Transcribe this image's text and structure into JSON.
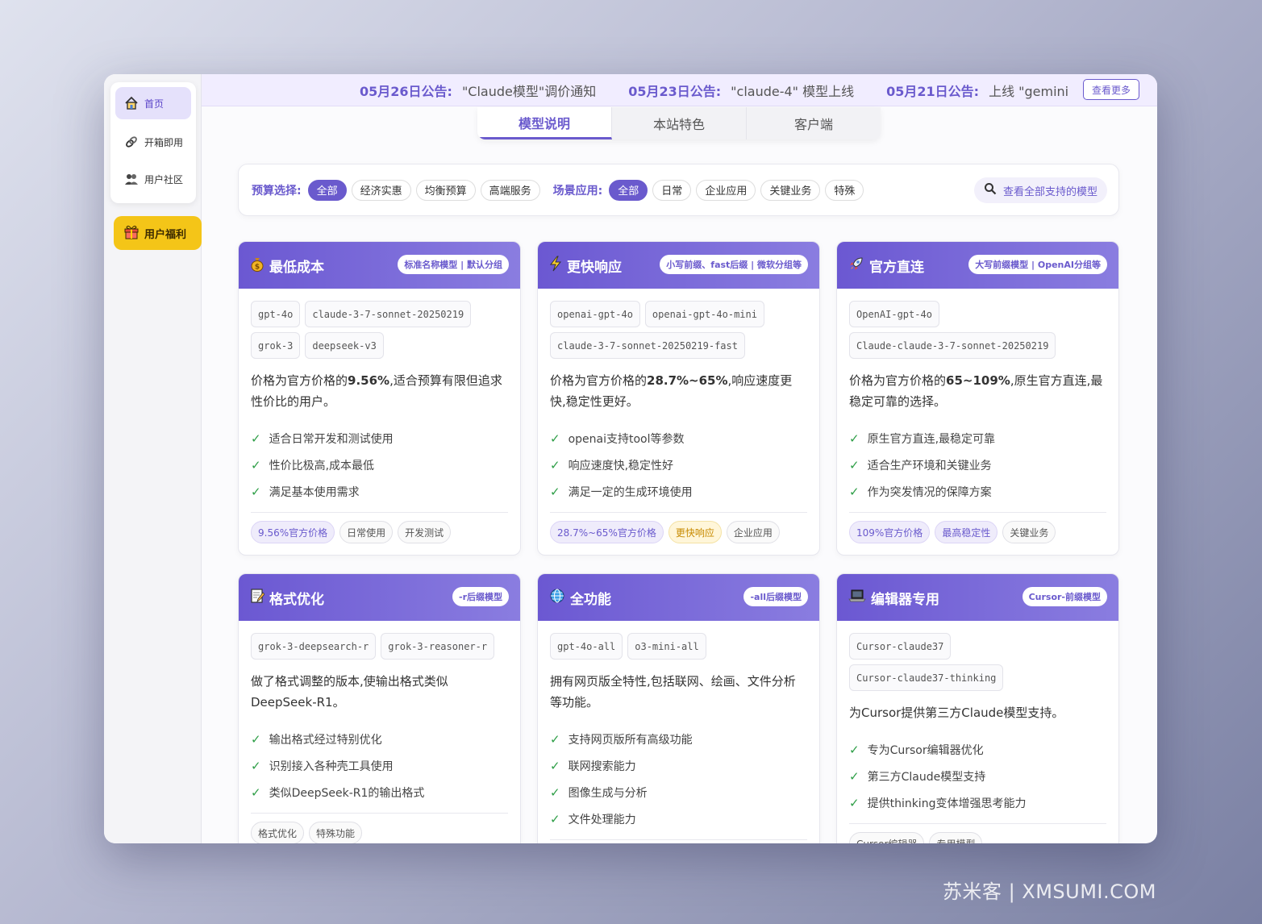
{
  "sidebar": {
    "items": [
      {
        "label": "首页",
        "icon": "home-icon"
      },
      {
        "label": "开箱即用",
        "icon": "link-icon"
      },
      {
        "label": "用户社区",
        "icon": "users-icon"
      }
    ],
    "benefit_label": "用户福利"
  },
  "announcements": [
    {
      "date": "05月26日公告:",
      "text": "\"Claude模型\"调价通知"
    },
    {
      "date": "05月23日公告:",
      "text": "\"claude-4\" 模型上线"
    },
    {
      "date": "05月21日公告:",
      "text": "上线 \"gemini"
    }
  ],
  "more_label": "查看更多",
  "tabs": [
    "模型说明",
    "本站特色",
    "客户端"
  ],
  "filter": {
    "budget_label": "预算选择:",
    "budget_options": [
      "全部",
      "经济实惠",
      "均衡预算",
      "高端服务"
    ],
    "scene_label": "场景应用:",
    "scene_options": [
      "全部",
      "日常",
      "企业应用",
      "关键业务",
      "特殊"
    ],
    "all_models_label": "查看全部支持的模型"
  },
  "cards": [
    {
      "title": "最低成本",
      "icon": "money-bag-icon",
      "badge": "标准名称模型 | 默认分组",
      "models": [
        "gpt-4o",
        "claude-3-7-sonnet-20250219",
        "grok-3",
        "deepseek-v3"
      ],
      "desc_pre": "价格为官方价格的",
      "desc_bold": "9.56%",
      "desc_post": ",适合预算有限但追求性价比的用户。",
      "features": [
        "适合日常开发和测试使用",
        "性价比极高,成本最低",
        "满足基本使用需求"
      ],
      "tags": [
        {
          "text": "9.56%官方价格",
          "style": "purple"
        },
        {
          "text": "日常使用",
          "style": "plain"
        },
        {
          "text": "开发测试",
          "style": "plain"
        }
      ]
    },
    {
      "title": "更快响应",
      "icon": "lightning-icon",
      "badge": "小写前缀、fast后缀 | 微软分组等",
      "models": [
        "openai-gpt-4o",
        "openai-gpt-4o-mini",
        "claude-3-7-sonnet-20250219-fast"
      ],
      "desc_pre": "价格为官方价格的",
      "desc_bold": "28.7%~65%",
      "desc_post": ",响应速度更快,稳定性更好。",
      "features": [
        "openai支持tool等参数",
        "响应速度快,稳定性好",
        "满足一定的生成环境使用"
      ],
      "tags": [
        {
          "text": "28.7%~65%官方价格",
          "style": "purple"
        },
        {
          "text": "更快响应",
          "style": "yellow"
        },
        {
          "text": "企业应用",
          "style": "plain"
        }
      ]
    },
    {
      "title": "官方直连",
      "icon": "rocket-icon",
      "badge": "大写前缀模型 | OpenAI分组等",
      "models": [
        "OpenAI-gpt-4o",
        "Claude-claude-3-7-sonnet-20250219"
      ],
      "desc_pre": "价格为官方价格的",
      "desc_bold": "65~109%",
      "desc_post": ",原生官方直连,最稳定可靠的选择。",
      "features": [
        "原生官方直连,最稳定可靠",
        "适合生产环境和关键业务",
        "作为突发情况的保障方案"
      ],
      "tags": [
        {
          "text": "109%官方价格",
          "style": "purple"
        },
        {
          "text": "最高稳定性",
          "style": "purple"
        },
        {
          "text": "关键业务",
          "style": "plain"
        }
      ]
    },
    {
      "title": "格式优化",
      "icon": "memo-icon",
      "badge": "-r后缀模型",
      "models": [
        "grok-3-deepsearch-r",
        "grok-3-reasoner-r"
      ],
      "desc_pre": "做了格式调整的版本,使输出格式类似DeepSeek-R1。",
      "desc_bold": "",
      "desc_post": "",
      "features": [
        "输出格式经过特别优化",
        "识别接入各种壳工具使用",
        "类似DeepSeek-R1的输出格式"
      ],
      "tags": [
        {
          "text": "格式优化",
          "style": "plain"
        },
        {
          "text": "特殊功能",
          "style": "plain"
        }
      ]
    },
    {
      "title": "全功能",
      "icon": "globe-icon",
      "badge": "-all后缀模型",
      "models": [
        "gpt-4o-all",
        "o3-mini-all"
      ],
      "desc_pre": "拥有网页版全特性,包括联网、绘画、文件分析等功能。",
      "desc_bold": "",
      "desc_post": "",
      "features": [
        "支持网页版所有高级功能",
        "联网搜索能力",
        "图像生成与分析",
        "文件处理能力"
      ],
      "tags": []
    },
    {
      "title": "编辑器专用",
      "icon": "laptop-icon",
      "badge": "Cursor-前缀模型",
      "models": [
        "Cursor-claude37",
        "Cursor-claude37-thinking"
      ],
      "desc_pre": "为Cursor提供第三方Claude模型支持。",
      "desc_bold": "",
      "desc_post": "",
      "features": [
        "专为Cursor编辑器优化",
        "第三方Claude模型支持",
        "提供thinking变体增强思考能力"
      ],
      "tags": [
        {
          "text": "Cursor编辑器",
          "style": "plain"
        },
        {
          "text": "专用模型",
          "style": "plain"
        }
      ]
    }
  ],
  "watermark": "苏米客 | XMSUMI.COM",
  "colors": {
    "accent": "#6a5acd",
    "benefit": "#f4c518",
    "check": "#2e9e47"
  }
}
